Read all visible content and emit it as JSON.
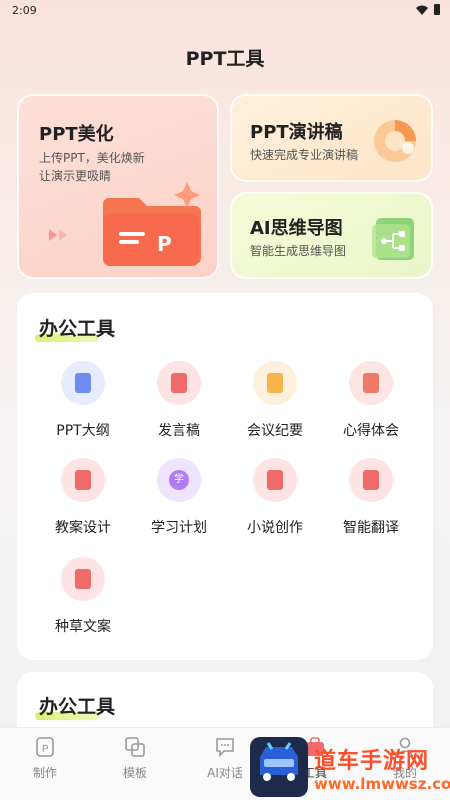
{
  "status": {
    "time": "2:09"
  },
  "header": {
    "title": "PPT工具"
  },
  "feature_cards": {
    "beautify": {
      "title": "PPT美化",
      "subtitle_line1": "上传PPT，美化焕新",
      "subtitle_line2": "让演示更吸睛",
      "folder_letter": "P"
    },
    "speech": {
      "title": "PPT演讲稿",
      "subtitle": "快速完成专业演讲稿"
    },
    "mindmap": {
      "title": "AI思维导图",
      "subtitle": "智能生成思维导图"
    }
  },
  "office_tools": {
    "title": "办公工具",
    "items": [
      {
        "label": "PPT大纲",
        "icon": "outline-icon",
        "color": "#6c8cf0"
      },
      {
        "label": "发言稿",
        "icon": "microphone-icon",
        "color": "#f26b6b"
      },
      {
        "label": "会议纪要",
        "icon": "meeting-icon",
        "color": "#f6b44a"
      },
      {
        "label": "心得体会",
        "icon": "profile-card-icon",
        "color": "#f07a6a"
      },
      {
        "label": "教案设计",
        "icon": "lesson-plan-icon",
        "color": "#f26b6b"
      },
      {
        "label": "学习计划",
        "icon": "study-icon",
        "color": "#b07cf2",
        "glyph": "学"
      },
      {
        "label": "小说创作",
        "icon": "book-icon",
        "color": "#f26b6b"
      },
      {
        "label": "智能翻译",
        "icon": "translate-book-icon",
        "color": "#f26b6b"
      },
      {
        "label": "种草文案",
        "icon": "copywriting-book-icon",
        "color": "#f26b6b"
      }
    ]
  },
  "second_section": {
    "title": "办公工具"
  },
  "bottom_nav": {
    "items": [
      {
        "label": "制作",
        "icon": "make-icon"
      },
      {
        "label": "模板",
        "icon": "template-icon"
      },
      {
        "label": "AI对话",
        "icon": "chat-icon"
      },
      {
        "label": "工具",
        "icon": "tools-icon"
      },
      {
        "label": "我的",
        "icon": "profile-icon"
      }
    ]
  },
  "watermark": {
    "title": "道车手游网",
    "url": "www.lmwwsz.com"
  },
  "colors": {
    "accent": "#f26b6b",
    "underline": "#d7f07a",
    "watermark": "#ff4d2a"
  }
}
